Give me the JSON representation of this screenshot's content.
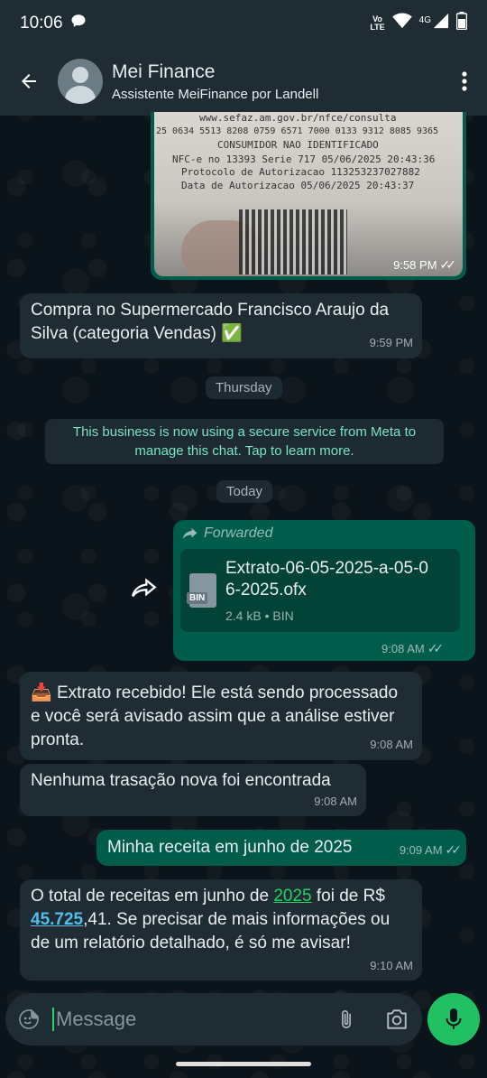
{
  "status": {
    "time": "10:06",
    "volte_top": "Vo",
    "volte_bottom": "LTE",
    "network": "4G"
  },
  "header": {
    "contact_name": "Mei Finance",
    "contact_subtitle": "Assistente MeiFinance por Landell"
  },
  "receipt_image": {
    "lines": [
      "www.sefaz.am.gov.br/nfce/consulta",
      "25 0634 5513 8208 0759 6571 7000 0133 9312 8085 9365",
      "CONSUMIDOR NAO IDENTIFICADO",
      "NFC-e no 13393 Serie 717 05/06/2025 20:43:36",
      "Protocolo de Autorizacao 113253237027882",
      "Data de Autorizacao 05/06/2025 20:43:37"
    ],
    "time": "9:58 PM"
  },
  "messages": {
    "m1": {
      "text": "Compra no Supermercado Francisco Araujo da Silva (categoria Vendas)",
      "emoji": "✅",
      "time": "9:59 PM"
    },
    "day1": "Thursday",
    "system": "This business is now using a secure service from Meta to manage this chat. Tap to learn more.",
    "day2": "Today",
    "forward": {
      "label": "Forwarded",
      "file_name": "Extrato-06-05-2025-a-05-06-2025.ofx",
      "file_badge": "BIN",
      "file_meta": "2.4 kB • BIN",
      "time": "9:08 AM"
    },
    "m2": {
      "emoji": "📥",
      "text": "Extrato recebido! Ele está sendo processado e você será avisado assim que a análise estiver pronta.",
      "time": "9:08 AM"
    },
    "m3": {
      "text": "Nenhuma trasação nova foi encontrada",
      "time": "9:08 AM"
    },
    "m4": {
      "text": "Minha receita em junho de 2025",
      "time": "9:09 AM"
    },
    "m5": {
      "part1": "O total de receitas em junho de ",
      "year": "2025",
      "part2": " foi de R$ ",
      "amount": "45.725",
      "part3": ",41. Se precisar de mais informações ou de um relatório detalhado, é só me avisar!",
      "time": "9:10 AM"
    }
  },
  "input": {
    "placeholder": "Message"
  },
  "colors": {
    "header": "#1f2c34",
    "incoming": "#202c33",
    "outgoing": "#005c4b",
    "accent": "#25d366",
    "link": "#53bdeb"
  }
}
